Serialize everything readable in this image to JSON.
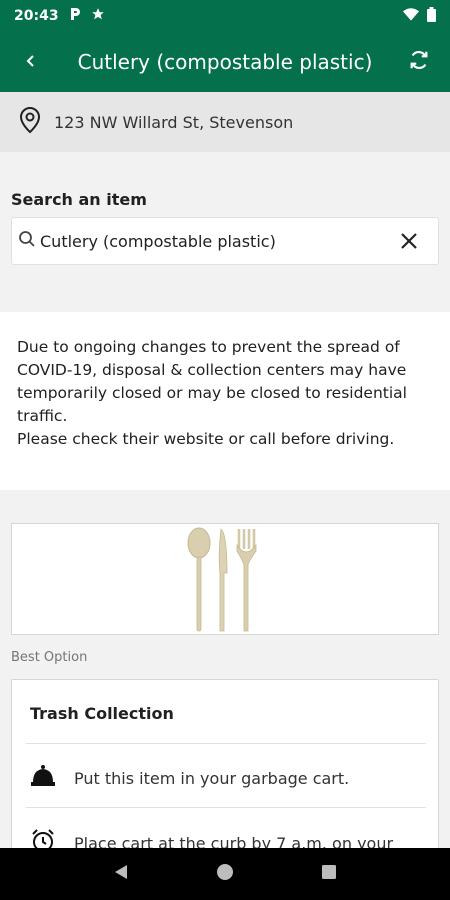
{
  "status_bar": {
    "time": "20:43",
    "icons": [
      "parking-icon",
      "star-icon",
      "wifi-icon",
      "battery-icon"
    ]
  },
  "app_bar": {
    "title": "Cutlery (compostable plastic)",
    "back_icon": "chevron-left-icon",
    "refresh_icon": "refresh-icon"
  },
  "address": {
    "icon": "location-pin-icon",
    "text": "123 NW Willard St, Stevenson"
  },
  "search": {
    "label": "Search an item",
    "value": "Cutlery (compostable plastic)",
    "icons": [
      "search-icon",
      "close-icon"
    ]
  },
  "notice": {
    "line1": "Due to ongoing changes to prevent the spread of COVID-19, disposal & collection centers may have temporarily closed or may be closed to residential traffic.",
    "line2": "Please check their website or call before driving."
  },
  "best_option_label": "Best Option",
  "card": {
    "title": "Trash Collection",
    "rows": [
      {
        "icon": "bell-icon",
        "text": "Put this item in your garbage cart."
      },
      {
        "icon": "alarm-clock-icon",
        "text": "Place cart at the curb by 7 a.m. on your"
      }
    ]
  },
  "nav_bar": {
    "icons": [
      "back-triangle-icon",
      "home-circle-icon",
      "recents-square-icon"
    ]
  },
  "colors": {
    "brand_green": "#04704c",
    "address_bg": "#e6e6e6",
    "page_bg": "#f2f2f2"
  }
}
